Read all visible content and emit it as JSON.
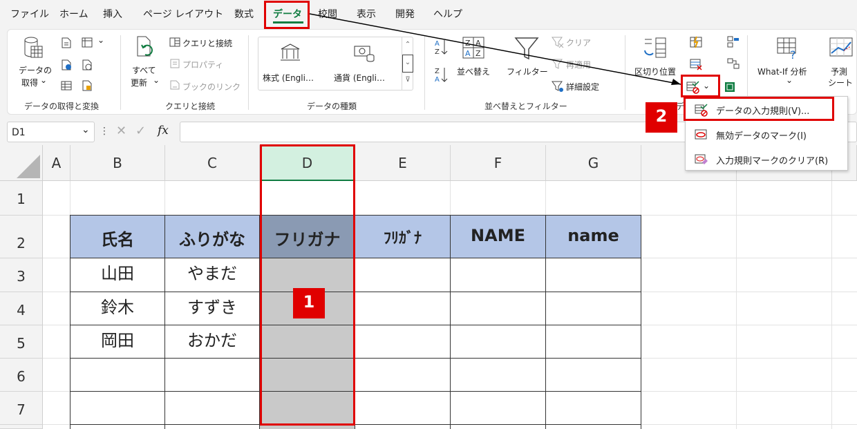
{
  "menu": [
    "ファイル",
    "ホーム",
    "挿入",
    "ページ レイアウト",
    "数式",
    "データ",
    "校閲",
    "表示",
    "開発",
    "ヘルプ"
  ],
  "ribbon": {
    "get_data_line1": "データの",
    "get_data_line2": "取得",
    "group_get": "データの取得と変換",
    "refresh_line1": "すべて",
    "refresh_line2": "更新",
    "query_conn": "クエリと接続",
    "properties": "プロパティ",
    "book_links": "ブックのリンク",
    "group_query": "クエリと接続",
    "stocks": "株式 (Engli…",
    "currency": "通貨 (Engli…",
    "group_types": "データの種類",
    "sort": "並べ替え",
    "filter": "フィルター",
    "clear": "クリア",
    "reapply": "再適用",
    "advanced": "詳細設定",
    "group_sort": "並べ替えとフィルター",
    "text_to_columns": "区切り位置",
    "group_tools": "データ ツール",
    "whatif": "What-If 分析",
    "forecast_line1": "予測",
    "forecast_line2": "シート"
  },
  "dropdown": {
    "validation": "データの入力規則(V)...",
    "circle_invalid": "無効データのマーク(I)",
    "clear_circles": "入力規則マークのクリア(R)"
  },
  "formula": {
    "namebox": "D1",
    "fx": "fx"
  },
  "columns": [
    "A",
    "B",
    "C",
    "D",
    "E",
    "F",
    "G"
  ],
  "rows": [
    "1",
    "2",
    "3",
    "4",
    "5",
    "6",
    "7"
  ],
  "table": {
    "headers": [
      "氏名",
      "ふりがな",
      "フリガナ",
      "ﾌﾘｶﾞﾅ",
      "NAME",
      "name"
    ],
    "data": [
      [
        "山田",
        "やまだ"
      ],
      [
        "鈴木",
        "すずき"
      ],
      [
        "岡田",
        "おかだ"
      ]
    ]
  },
  "badges": [
    "1",
    "2"
  ],
  "colors": {
    "accent": "#107c41",
    "highlight": "#e00000",
    "header_fill": "#b4c6e7"
  }
}
